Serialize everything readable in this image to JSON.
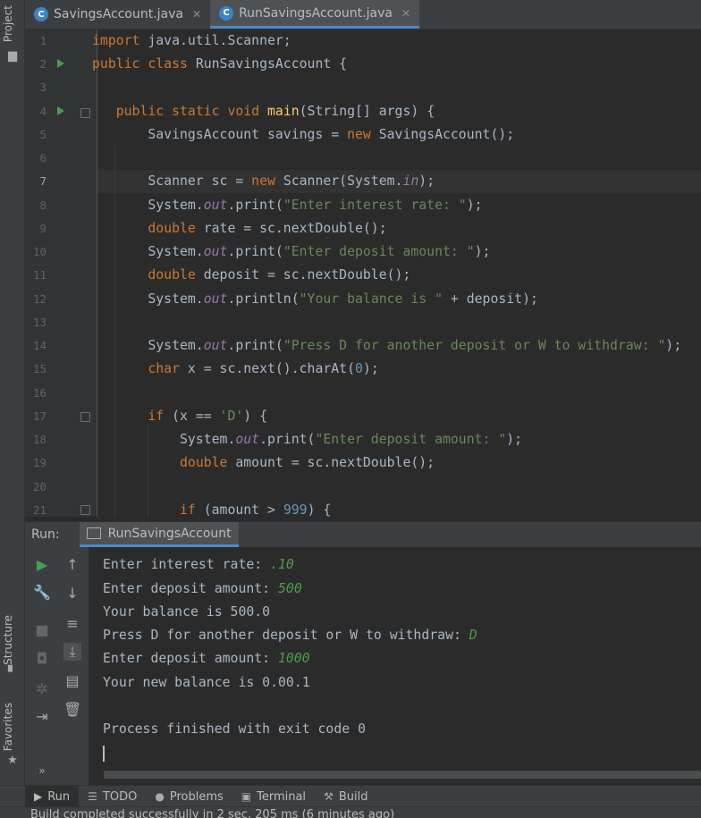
{
  "sidebar": {
    "project_label": "Project",
    "structure_label": "Structure",
    "favorites_label": "Favorites"
  },
  "tabs": [
    {
      "label": "SavingsAccount.java",
      "icon": "class-icon",
      "active": false
    },
    {
      "label": "RunSavingsAccount.java",
      "icon": "class-icon",
      "active": true
    }
  ],
  "editor": {
    "current_line": 7,
    "line_numbers": [
      "1",
      "2",
      "3",
      "4",
      "5",
      "6",
      "7",
      "8",
      "9",
      "10",
      "11",
      "12",
      "13",
      "14",
      "15",
      "16",
      "17",
      "18",
      "19",
      "20",
      "21"
    ]
  },
  "run_panel": {
    "label": "Run:",
    "tab_label": "RunSavingsAccount"
  },
  "console": {
    "lines": [
      {
        "text": "Enter interest rate: ",
        "input": ".10"
      },
      {
        "text": "Enter deposit amount: ",
        "input": "500"
      },
      {
        "text": "Your balance is 500.0",
        "input": ""
      },
      {
        "text": "Press D for another deposit or W to withdraw: ",
        "input": "D"
      },
      {
        "text": "Enter deposit amount: ",
        "input": "1000"
      },
      {
        "text": "Your new balance is 0.00.1",
        "input": ""
      },
      {
        "text": "",
        "input": ""
      },
      {
        "text": "Process finished with exit code 0",
        "input": ""
      }
    ]
  },
  "bottom_tabs": [
    {
      "label": "Run",
      "icon": "play-icon"
    },
    {
      "label": "TODO",
      "icon": "list-icon"
    },
    {
      "label": "Problems",
      "icon": "problems-icon"
    },
    {
      "label": "Terminal",
      "icon": "terminal-icon"
    },
    {
      "label": "Build",
      "icon": "hammer-icon"
    }
  ],
  "status": {
    "message": "Build completed successfully in 2 sec, 205 ms (6 minutes ago)"
  },
  "colors": {
    "keyword": "#cc7832",
    "string": "#6a8759",
    "number": "#6897bb",
    "field": "#9876aa",
    "method": "#ffc66d",
    "user_input": "#4f9b50",
    "accent": "#4a88c7"
  }
}
